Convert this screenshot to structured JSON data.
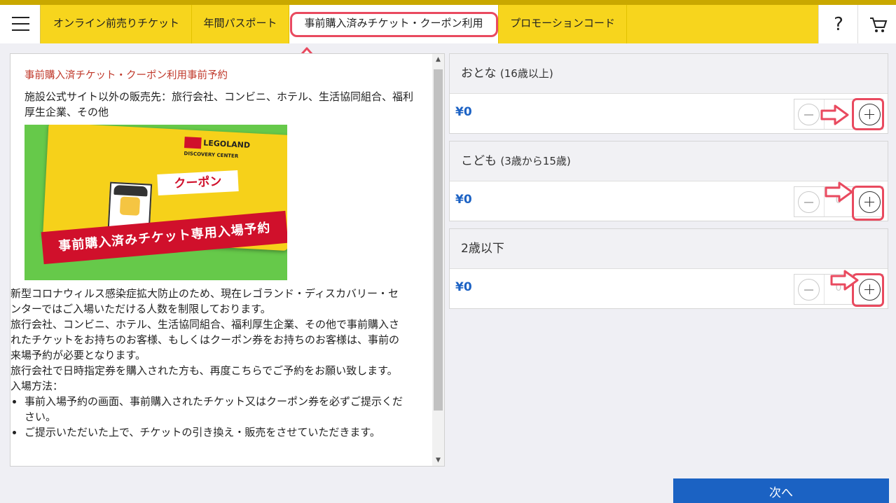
{
  "nav": {
    "tabs": [
      {
        "label": "オンライン前売りチケット"
      },
      {
        "label": "年間パスポート"
      },
      {
        "label": "事前購入済みチケット・クーポン利用"
      },
      {
        "label": "プロモーションコード"
      }
    ],
    "help_label": "?",
    "icons": [
      "hamburger-menu-icon",
      "cart-icon"
    ]
  },
  "left_panel": {
    "title": "事前購入済チケット・クーポン利用事前予約",
    "sellers": "施設公式サイト以外の販売先：旅行会社、コンビニ、ホテル、生活協同組合、福利厚生企業、その他",
    "image": {
      "logo_text": "LEGOLAND",
      "logo_sub": "DISCOVERY CENTER",
      "coupon_label": "クーポン",
      "banner_text": "事前購入済みチケット専用入場予約"
    },
    "paragraphs": [
      "新型コロナウィルス感染症拡大防止のため、現在レゴランド・ディスカバリー・センターではご入場いただける人数を制限しております。",
      "旅行会社、コンビニ、ホテル、生活協同組合、福利厚生企業、その他で事前購入されたチケットをお持ちのお客様、もしくはクーポン券をお持ちのお客様は、事前の来場予約が必要となります。",
      "旅行会社で日時指定券を購入された方も、再度こちらでご予約をお願い致します。",
      "入場方法："
    ],
    "bullets": [
      "事前入場予約の画面、事前購入されたチケット又はクーポン券を必ずご提示ください。",
      "ご提示いただいた上で、チケットの引き換え・販売をさせていただきます。"
    ]
  },
  "tickets": [
    {
      "name": "おとな",
      "note": "(16歳以上)",
      "price": "¥0",
      "quantity": "0"
    },
    {
      "name": "こども",
      "note": "(3歳から15歳)",
      "price": "¥0",
      "quantity": "0"
    },
    {
      "name": "2歳以下",
      "note": "",
      "price": "¥0",
      "quantity": "0"
    }
  ],
  "next_button": "次へ",
  "colors": {
    "nav_yellow": "#f7d51d",
    "price_blue": "#1c62c4",
    "annotation_red": "#e94a5f",
    "button_blue": "#1b62c3",
    "title_red": "#c0392b"
  }
}
